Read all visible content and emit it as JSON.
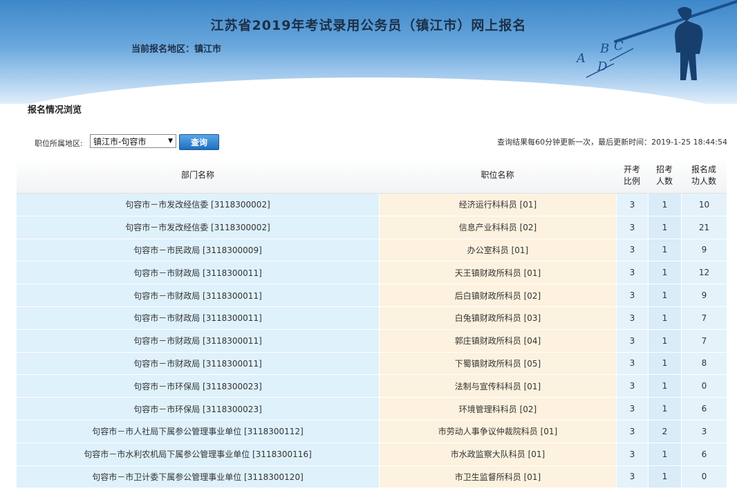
{
  "header": {
    "title": "江苏省2019年考试录用公务员（镇江市）网上报名",
    "region_label": "当前报名地区：镇江市",
    "art_letters": [
      "A",
      "B",
      "C",
      "D"
    ]
  },
  "section_title": "报名情况浏览",
  "filter": {
    "label": "职位所属地区:",
    "selected": "镇江市-句容市",
    "query_button": "查询",
    "update_info": "查询结果每60分钟更新一次，最后更新时间：2019-1-25 18:44:54"
  },
  "table": {
    "headers": {
      "dept": "部门名称",
      "position": "职位名称",
      "ratio_1": "开考",
      "ratio_2": "比例",
      "hire_1": "招考",
      "hire_2": "人数",
      "applied_1": "报名成",
      "applied_2": "功人数"
    },
    "rows": [
      {
        "dept": "句容市－市发改经信委 [3118300002]",
        "position": "经济运行科科员 [01]",
        "ratio": "3",
        "hire": "1",
        "applied": "10"
      },
      {
        "dept": "句容市－市发改经信委 [3118300002]",
        "position": "信息产业科科员 [02]",
        "ratio": "3",
        "hire": "1",
        "applied": "21"
      },
      {
        "dept": "句容市－市民政局 [3118300009]",
        "position": "办公室科员 [01]",
        "ratio": "3",
        "hire": "1",
        "applied": "9"
      },
      {
        "dept": "句容市－市财政局 [3118300011]",
        "position": "天王镇财政所科员 [01]",
        "ratio": "3",
        "hire": "1",
        "applied": "12"
      },
      {
        "dept": "句容市－市财政局 [3118300011]",
        "position": "后白镇财政所科员 [02]",
        "ratio": "3",
        "hire": "1",
        "applied": "9"
      },
      {
        "dept": "句容市－市财政局 [3118300011]",
        "position": "白兔镇财政所科员 [03]",
        "ratio": "3",
        "hire": "1",
        "applied": "7"
      },
      {
        "dept": "句容市－市财政局 [3118300011]",
        "position": "郭庄镇财政所科员 [04]",
        "ratio": "3",
        "hire": "1",
        "applied": "7"
      },
      {
        "dept": "句容市－市财政局 [3118300011]",
        "position": "下蜀镇财政所科员 [05]",
        "ratio": "3",
        "hire": "1",
        "applied": "8"
      },
      {
        "dept": "句容市－市环保局 [3118300023]",
        "position": "法制与宣传科科员 [01]",
        "ratio": "3",
        "hire": "1",
        "applied": "0"
      },
      {
        "dept": "句容市－市环保局 [3118300023]",
        "position": "环境管理科科员 [02]",
        "ratio": "3",
        "hire": "1",
        "applied": "6"
      },
      {
        "dept": "句容市－市人社局下属参公管理事业单位 [3118300112]",
        "position": "市劳动人事争议仲裁院科员 [01]",
        "ratio": "3",
        "hire": "2",
        "applied": "3"
      },
      {
        "dept": "句容市－市水利农机局下属参公管理事业单位 [3118300116]",
        "position": "市水政监察大队科员 [01]",
        "ratio": "3",
        "hire": "1",
        "applied": "6"
      },
      {
        "dept": "句容市－市卫计委下属参公管理事业单位 [3118300120]",
        "position": "市卫生监督所科员 [01]",
        "ratio": "3",
        "hire": "1",
        "applied": "0"
      }
    ]
  }
}
